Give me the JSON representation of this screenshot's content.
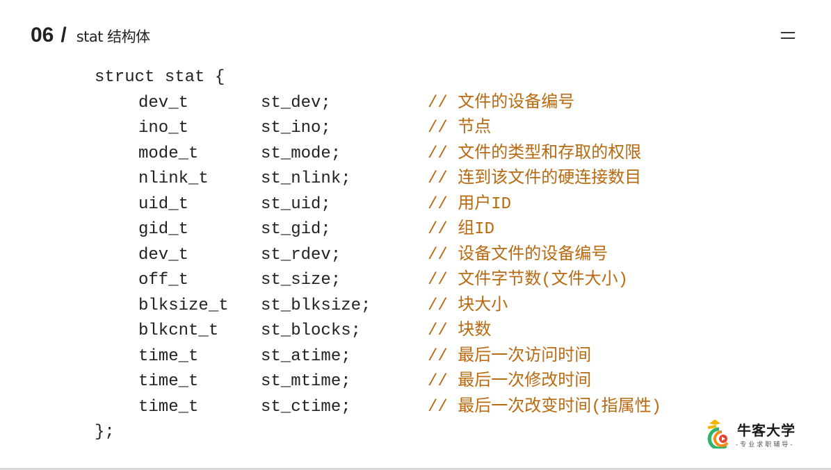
{
  "header": {
    "number": "06",
    "slash": "/",
    "title": "stat 结构体"
  },
  "menu": {
    "icon": "menu-icon"
  },
  "code": {
    "open": "struct stat {",
    "close": "};",
    "fields": [
      {
        "type": "dev_t",
        "member": "st_dev;",
        "comment": "// 文件的设备编号"
      },
      {
        "type": "ino_t",
        "member": "st_ino;",
        "comment": "// 节点"
      },
      {
        "type": "mode_t",
        "member": "st_mode;",
        "comment": "// 文件的类型和存取的权限"
      },
      {
        "type": "nlink_t",
        "member": "st_nlink;",
        "comment": "// 连到该文件的硬连接数目"
      },
      {
        "type": "uid_t",
        "member": "st_uid;",
        "comment": "// 用户ID"
      },
      {
        "type": "gid_t",
        "member": "st_gid;",
        "comment": "// 组ID"
      },
      {
        "type": "dev_t",
        "member": "st_rdev;",
        "comment": "// 设备文件的设备编号"
      },
      {
        "type": "off_t",
        "member": "st_size;",
        "comment": "// 文件字节数(文件大小)"
      },
      {
        "type": "blksize_t",
        "member": "st_blksize;",
        "comment": "// 块大小"
      },
      {
        "type": "blkcnt_t",
        "member": "st_blocks;",
        "comment": "// 块数"
      },
      {
        "type": "time_t",
        "member": "st_atime;",
        "comment": "// 最后一次访问时间"
      },
      {
        "type": "time_t",
        "member": "st_mtime;",
        "comment": "// 最后一次修改时间"
      },
      {
        "type": "time_t",
        "member": "st_ctime;",
        "comment": "// 最后一次改变时间(指属性)"
      }
    ]
  },
  "logo": {
    "name": "牛客大学",
    "tagline": "-专业求职辅导-",
    "colors": {
      "yellow": "#f5b400",
      "green": "#2fb56a",
      "orange": "#f28a1e",
      "red": "#e8432e"
    }
  },
  "colors": {
    "text": "#222222",
    "comment": "#b86a12",
    "background": "#ffffff"
  }
}
